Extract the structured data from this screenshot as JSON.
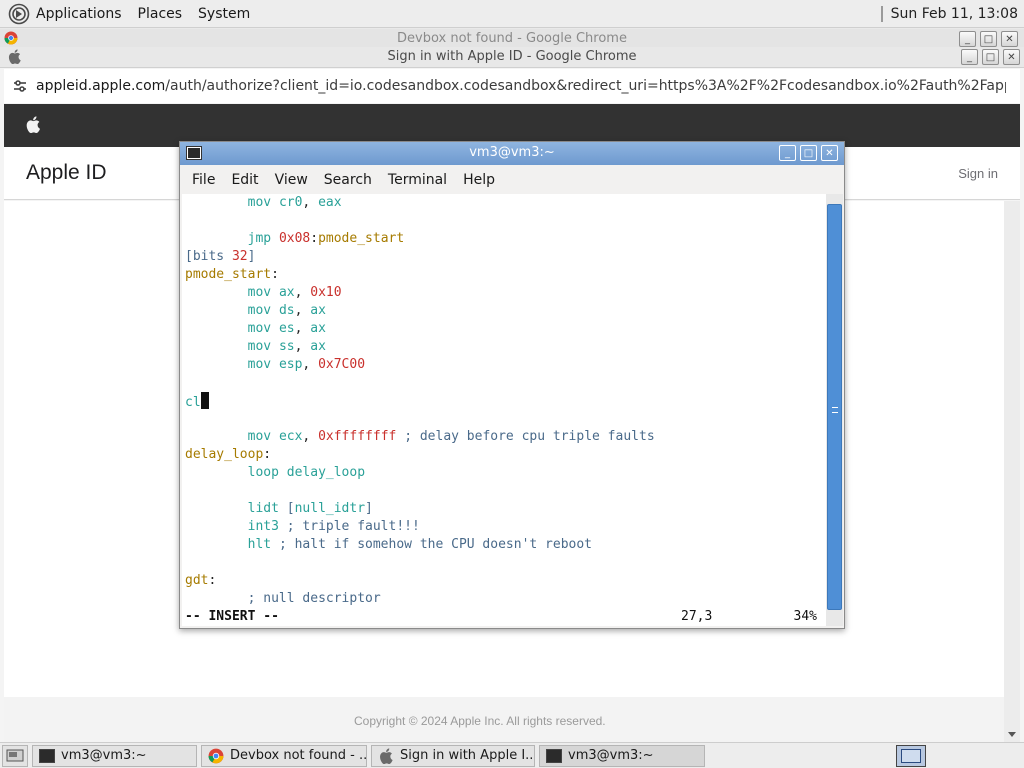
{
  "top_panel": {
    "menus": [
      "Applications",
      "Places",
      "System"
    ],
    "clock": "Sun Feb 11, 13:08"
  },
  "background_window": {
    "title": "Devbox not found - Google Chrome"
  },
  "chrome": {
    "title": "Sign in with Apple ID - Google Chrome",
    "url_host": "appleid.apple.com",
    "url_rest": "/auth/authorize?client_id=io.codesandbox.codesandbox&redirect_uri=https%3A%2F%2Fcodesandbox.io%2Fauth%2Fapple%2Fcallb…",
    "page": {
      "brand": "Apple ID",
      "sign_in": "Sign in",
      "footer": "Copyright © 2024 Apple Inc. All rights reserved."
    }
  },
  "terminal": {
    "title": "vm3@vm3:~",
    "menu": [
      "File",
      "Edit",
      "View",
      "Search",
      "Terminal",
      "Help"
    ],
    "status": {
      "mode": "-- INSERT --",
      "position": "27,3",
      "percent": "34%"
    }
  },
  "taskbar": {
    "tasks": [
      "vm3@vm3:~",
      "Devbox not found - ...",
      "Sign in with Apple I...",
      "vm3@vm3:~"
    ]
  },
  "colors": {
    "vim_keyword": "#2aa198",
    "vim_number": "#c9302c",
    "vim_label": "#a67b00",
    "vim_comment": "#4a6a8a",
    "terminal_titlebar": "#7ba3d6",
    "apple_nav": "#323232"
  }
}
